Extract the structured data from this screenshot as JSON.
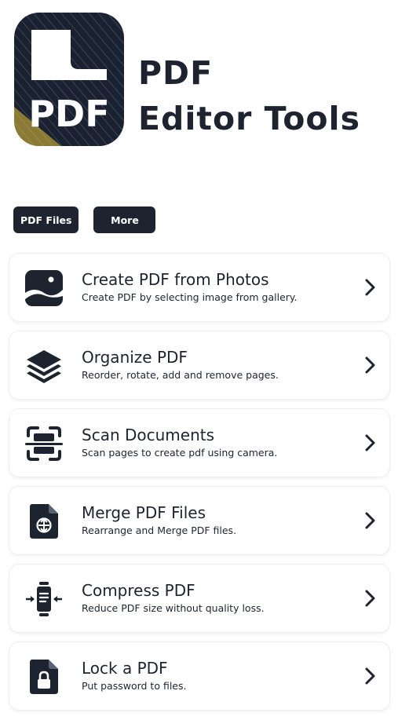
{
  "header": {
    "logo_text": "PDF",
    "title_line1": "PDF",
    "title_line2": "Editor Tools"
  },
  "chips": [
    {
      "label": "PDF Files"
    },
    {
      "label": "More"
    }
  ],
  "tools": [
    {
      "title": "Create PDF from Photos",
      "description": "Create PDF by selecting image from gallery.",
      "icon": "image-icon"
    },
    {
      "title": "Organize PDF",
      "description": "Reorder, rotate, add and remove pages.",
      "icon": "layers-icon"
    },
    {
      "title": "Scan Documents",
      "description": "Scan pages to create pdf using camera.",
      "icon": "scan-icon"
    },
    {
      "title": "Merge PDF Files",
      "description": "Rearrange and Merge PDF files.",
      "icon": "merge-file-icon"
    },
    {
      "title": "Compress PDF",
      "description": "Reduce PDF size without quality loss.",
      "icon": "compress-icon"
    },
    {
      "title": "Lock a PDF",
      "description": "Put password to files.",
      "icon": "lock-file-icon"
    }
  ],
  "colors": {
    "primary": "#1e2330",
    "logo_dark": "#1a2130",
    "logo_accent": "#e8c53a",
    "background": "#ffffff"
  }
}
